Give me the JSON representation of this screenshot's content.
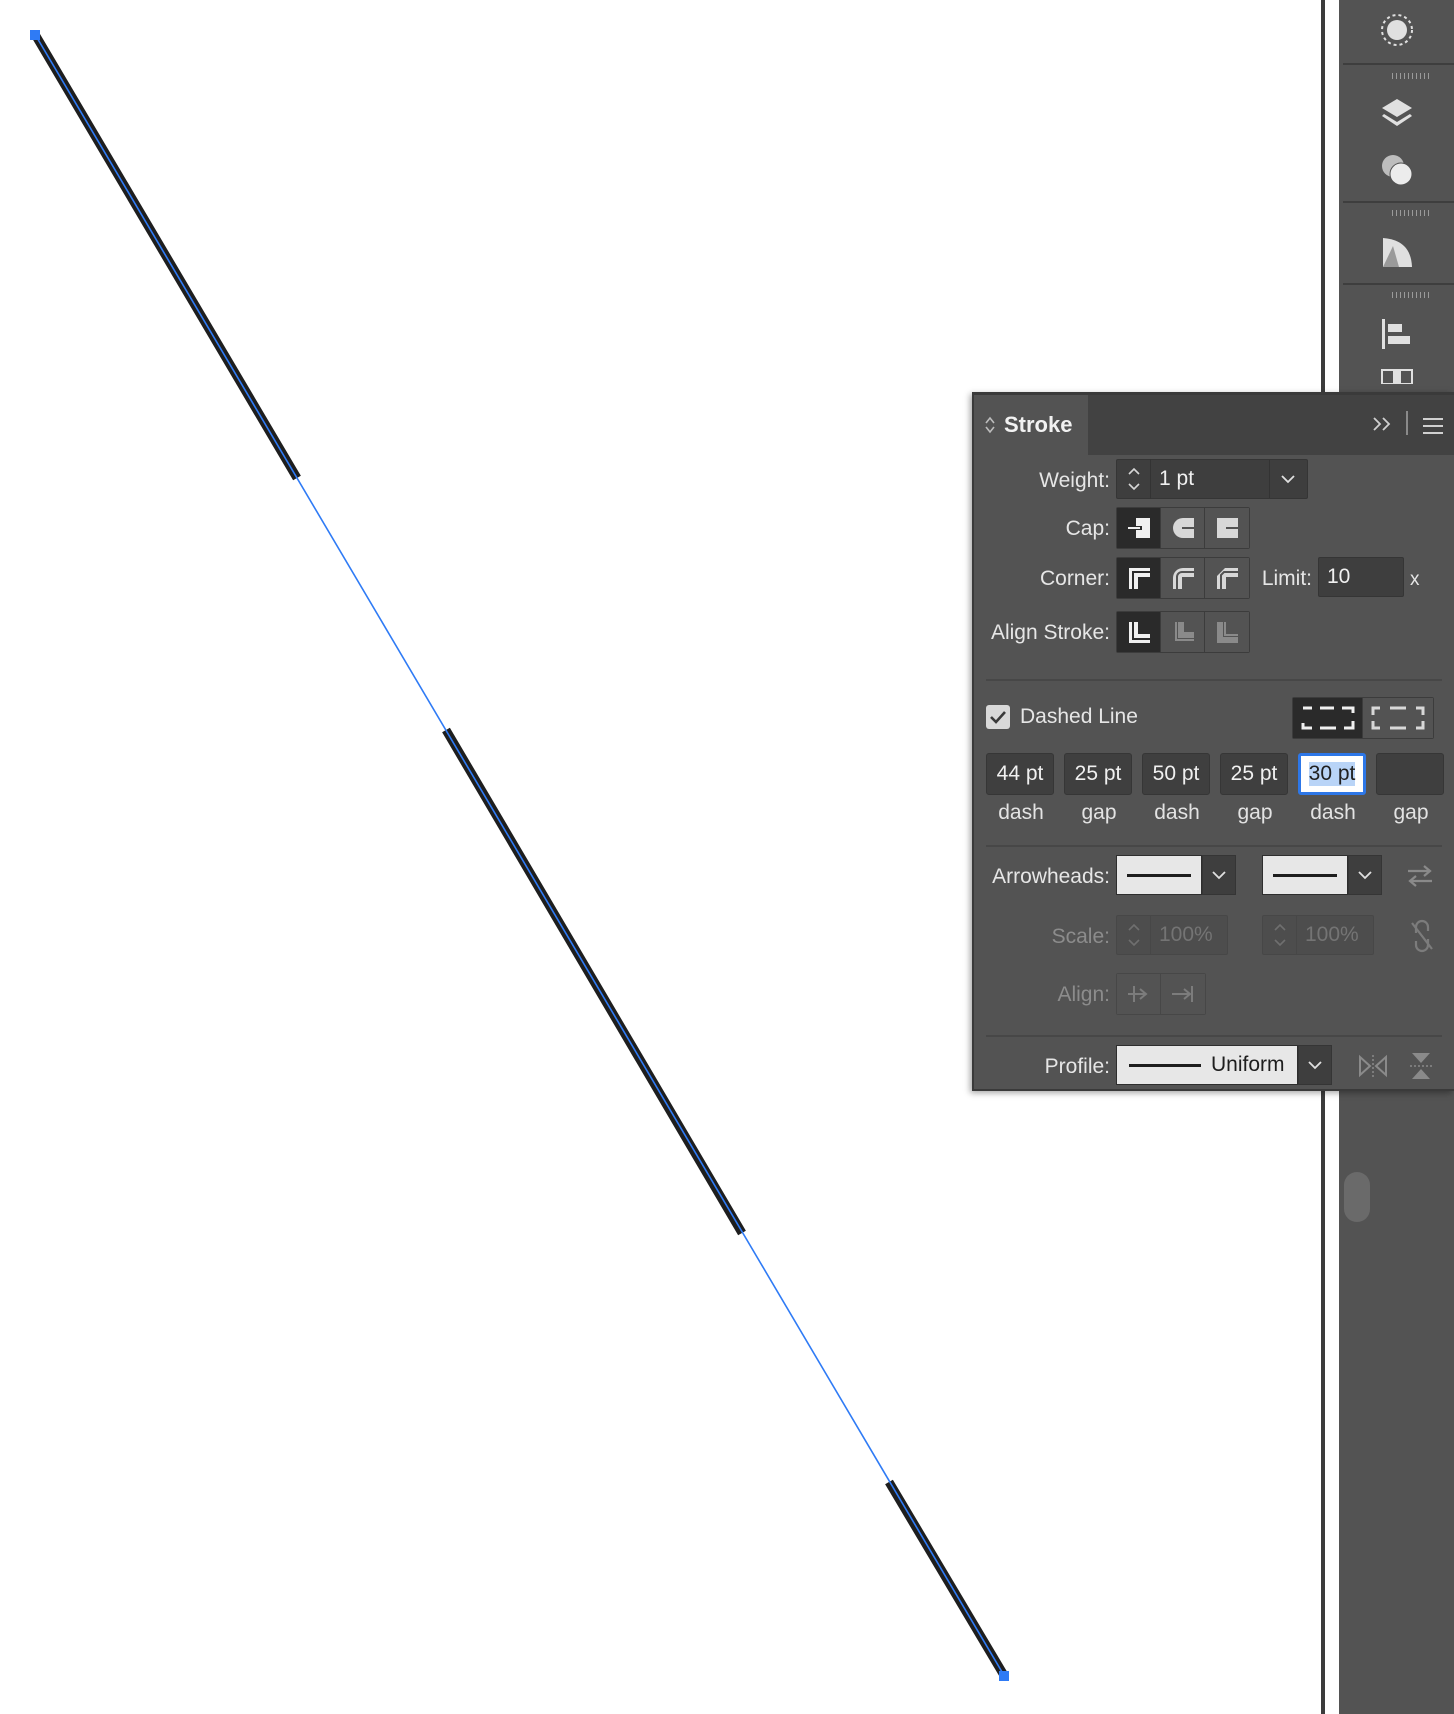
{
  "panel": {
    "title": "Stroke",
    "weight": {
      "label": "Weight:",
      "value": "1 pt"
    },
    "cap": {
      "label": "Cap:",
      "options": [
        "butt-cap-icon",
        "round-cap-icon",
        "projecting-cap-icon"
      ],
      "selected": 0
    },
    "corner": {
      "label": "Corner:",
      "options": [
        "miter-join-icon",
        "round-join-icon",
        "bevel-join-icon"
      ],
      "selected": 0
    },
    "limit": {
      "label": "Limit:",
      "value": "10",
      "suffix": "x"
    },
    "align_stroke": {
      "label": "Align Stroke:",
      "selected": 0
    },
    "dashed_line": {
      "label": "Dashed Line",
      "checked": true
    },
    "dash_fields": [
      {
        "value": "44 pt",
        "caption": "dash"
      },
      {
        "value": "25 pt",
        "caption": "gap"
      },
      {
        "value": "50 pt",
        "caption": "dash"
      },
      {
        "value": "25 pt",
        "caption": "gap"
      },
      {
        "value": "30 pt",
        "caption": "dash"
      },
      {
        "value": "",
        "caption": "gap"
      }
    ],
    "arrowheads": {
      "label": "Arrowheads:"
    },
    "scale": {
      "label": "Scale:",
      "start": "100%",
      "end": "100%"
    },
    "align": {
      "label": "Align:"
    },
    "profile": {
      "label": "Profile:",
      "value": "Uniform"
    }
  },
  "colors": {
    "selection": "#2f7bf5",
    "stroke": "#1e1e1e",
    "panel_bg": "#535353",
    "tab_bar": "#424242",
    "field_bg": "#3e3e3e"
  },
  "dock_icons": [
    "appearance-icon",
    "layers-icon",
    "transparency-icon",
    "gradient-icon",
    "align-icon",
    "transform-icon"
  ]
}
